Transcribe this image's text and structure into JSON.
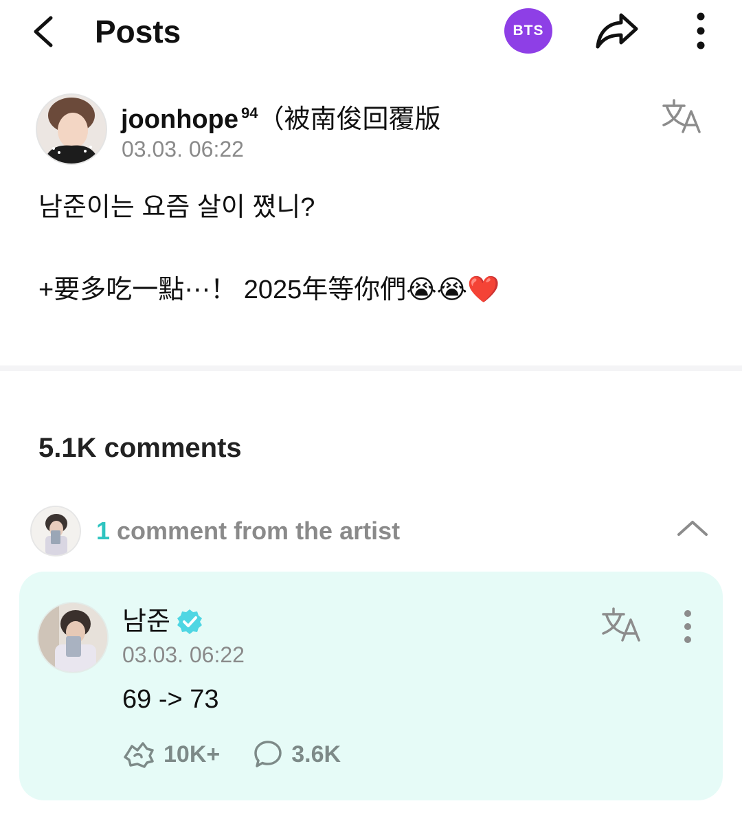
{
  "header": {
    "title": "Posts",
    "community_badge": "BTS",
    "badge_color": "#8e3fe6",
    "icons": [
      "back-arrow-icon",
      "share-icon",
      "more-vertical-icon"
    ]
  },
  "post": {
    "author_name": "joonhope",
    "author_superscript": "94",
    "author_suffix": "（被南俊回覆版",
    "timestamp": "03.03. 06:22",
    "line1": "남준이는 요즘 살이 쪘니?",
    "line2": "+要多吃一點⋯！  2025年等你們😭😭❤️"
  },
  "comments": {
    "count_label": "5.1K comments"
  },
  "artist_comments": {
    "count": "1",
    "label": "comment from the artist",
    "accent_color": "#2ec4c0",
    "card_color": "#e6fbf7",
    "comment": {
      "author": "남준",
      "timestamp": "03.03. 06:22",
      "text": "69 -> 73",
      "likes": "10K+",
      "replies": "3.6K"
    }
  }
}
